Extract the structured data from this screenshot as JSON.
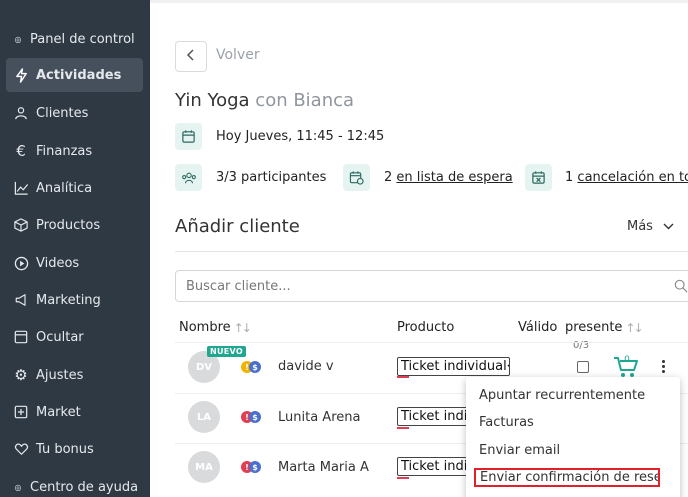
{
  "sidebar": {
    "items": [
      {
        "label": "Panel de control",
        "icon": "circle-dot-icon",
        "active": false
      },
      {
        "label": "Actividades",
        "icon": "lightning-icon",
        "active": true
      },
      {
        "label": "Clientes",
        "icon": "user-icon",
        "active": false
      },
      {
        "label": "Finanzas",
        "icon": "euro-icon",
        "active": false
      },
      {
        "label": "Analítica",
        "icon": "chart-line-icon",
        "active": false
      },
      {
        "label": "Productos",
        "icon": "box-icon",
        "active": false
      },
      {
        "label": "Videos",
        "icon": "play-icon",
        "active": false
      },
      {
        "label": "Marketing",
        "icon": "megaphone-icon",
        "active": false
      },
      {
        "label": "Ocultar",
        "icon": "panel-icon",
        "active": false
      },
      {
        "label": "Ajustes",
        "icon": "gear-icon",
        "active": false
      },
      {
        "label": "Market",
        "icon": "plus-square-icon",
        "active": false
      },
      {
        "label": "Tu bonus",
        "icon": "heart-icon",
        "active": false
      },
      {
        "label": "Centro de ayuda",
        "icon": "circle-dot-icon",
        "active": false
      }
    ]
  },
  "header": {
    "back_label": "Volver",
    "title": "Yin Yoga",
    "subtitle": "con Bianca"
  },
  "info": {
    "datetime": "Hoy Jueves, 11:45 - 12:45",
    "participants": "3/3 participantes",
    "waitlist_count": "2",
    "waitlist_link": "en lista de espera",
    "cancel_count": "1",
    "cancel_link": "cancelación en total"
  },
  "add_client": {
    "title": "Añadir cliente",
    "more_label": "Más",
    "search_placeholder": "Buscar cliente..."
  },
  "table": {
    "columns": {
      "name": "Nombre",
      "product": "Producto",
      "valid": "Válido",
      "present": "presente"
    },
    "present_count": "0/3",
    "new_badge": "NUEVO",
    "rows": [
      {
        "initials": "DV",
        "name": "davide v",
        "product": "Ticket individual",
        "status_color": "#f0b400"
      },
      {
        "initials": "LA",
        "name": "Lunita Arena",
        "product": "Ticket individual",
        "status_color": "#e03e52"
      },
      {
        "initials": "MA",
        "name": "Marta Maria A",
        "product": "Ticket individual",
        "status_color": "#e03e52"
      }
    ]
  },
  "menu": {
    "items": [
      "Apuntar recurrentemente",
      "Facturas",
      "Enviar email",
      "Enviar confirmación de reserva"
    ]
  },
  "colors": {
    "sidebar_bg": "#2f3944",
    "accent": "#1fa792",
    "alert": "#e03e52",
    "highlight_border": "#e0202a"
  }
}
